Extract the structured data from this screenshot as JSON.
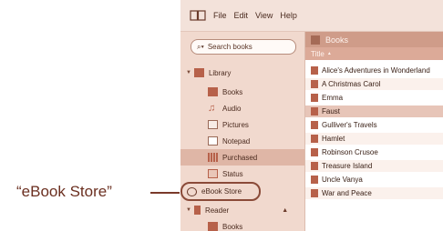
{
  "callout": {
    "text": "“eBook Store”"
  },
  "menubar": {
    "items": [
      "File",
      "Edit",
      "View",
      "Help"
    ]
  },
  "sidebar": {
    "search_placeholder": "Search books",
    "library_label": "Library",
    "library_items": [
      {
        "label": "Books",
        "icon": "book-icon"
      },
      {
        "label": "Audio",
        "icon": "music-note-icon"
      },
      {
        "label": "Pictures",
        "icon": "picture-icon"
      },
      {
        "label": "Notepad",
        "icon": "notepad-icon"
      },
      {
        "label": "Purchased",
        "icon": "purchased-icon"
      },
      {
        "label": "Status",
        "icon": "status-icon"
      }
    ],
    "store_label": "eBook Store",
    "reader_label": "Reader",
    "reader_items": [
      {
        "label": "Books",
        "icon": "book-icon"
      }
    ]
  },
  "content": {
    "header_title": "Books",
    "column_title": "Title",
    "sort_indicator": "▲",
    "books": [
      "Alice's Adventures in Wonderland",
      "A Christmas Carol",
      "Emma",
      "Faust",
      "Gulliver's Travels",
      "Hamlet",
      "Robinson Crusoe",
      "Treasure Island",
      "Uncle Vanya",
      "War and Peace"
    ]
  },
  "colors": {
    "accent": "#cf9c89",
    "sidebar": "#f1d9ce",
    "selection": "#dfb6a6"
  }
}
